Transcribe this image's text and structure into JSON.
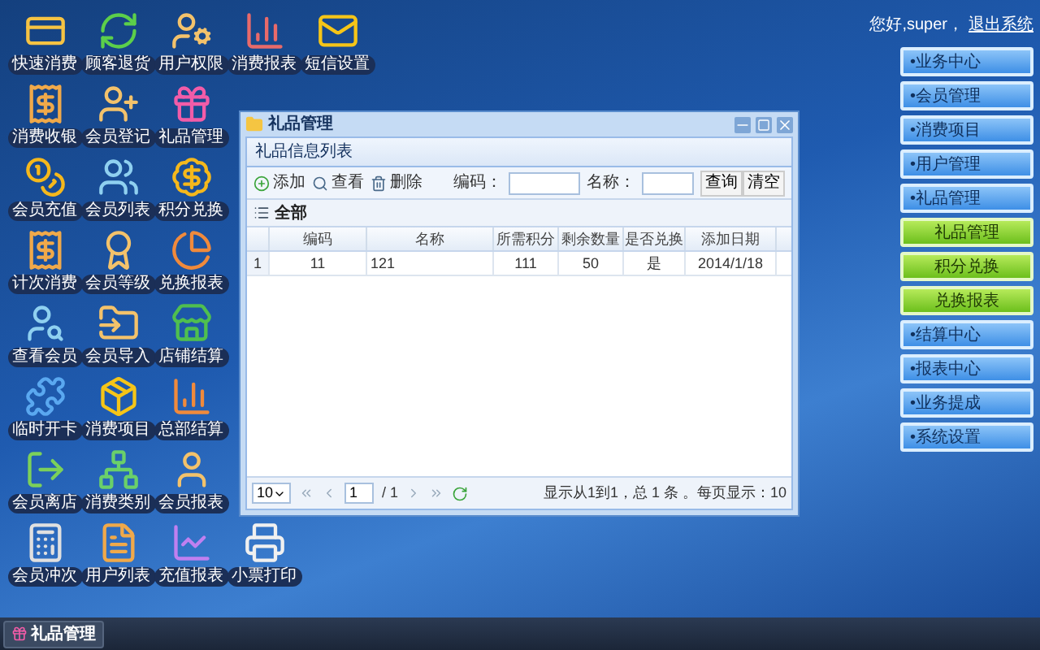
{
  "desktop_icons": [
    [
      "快速消费",
      "顾客退货",
      "用户权限",
      "消费报表",
      "短信设置"
    ],
    [
      "消费收银",
      "会员登记",
      "礼品管理"
    ],
    [
      "会员充值",
      "会员列表",
      "积分兑换"
    ],
    [
      "计次消费",
      "会员等级",
      "兑换报表"
    ],
    [
      "查看会员",
      "会员导入",
      "店铺结算"
    ],
    [
      "临时开卡",
      "消费项目",
      "总部结算"
    ],
    [
      "会员离店",
      "消费类别",
      "会员报表"
    ],
    [
      "会员冲次",
      "用户列表",
      "充值报表",
      "小票打印"
    ]
  ],
  "user_bar": {
    "greeting": "您好,super，",
    "logout": "退出系统"
  },
  "sidebar": {
    "items": [
      {
        "kind": "section",
        "label": "•业务中心"
      },
      {
        "kind": "section",
        "label": "•会员管理"
      },
      {
        "kind": "section",
        "label": "•消费项目"
      },
      {
        "kind": "section",
        "label": "•用户管理"
      },
      {
        "kind": "section",
        "label": "•礼品管理"
      },
      {
        "kind": "sub",
        "label": "礼品管理"
      },
      {
        "kind": "sub",
        "label": "积分兑换"
      },
      {
        "kind": "sub",
        "label": "兑换报表"
      },
      {
        "kind": "section",
        "label": "•结算中心"
      },
      {
        "kind": "section",
        "label": "•报表中心"
      },
      {
        "kind": "section",
        "label": "•业务提成"
      },
      {
        "kind": "section",
        "label": "•系统设置"
      }
    ]
  },
  "window": {
    "title": "礼品管理",
    "panel_title": "礼品信息列表",
    "toolbar": {
      "buttons": [
        "添加",
        "查看",
        "删除"
      ],
      "code_label": "编码：",
      "name_label": "名称：",
      "search": "查询",
      "clear": "清空"
    },
    "group": "全部",
    "table": {
      "columns": [
        "",
        "编码",
        "名称",
        "所需积分",
        "剩余数量",
        "是否兑换",
        "添加日期"
      ],
      "rows": [
        [
          "1",
          "11",
          "121",
          "111",
          "50",
          "是",
          "2014/1/18"
        ]
      ]
    },
    "pager": {
      "page_size": "10",
      "page": "1",
      "of": "/ 1",
      "summary": "显示从1到1，总 1 条 。每页显示：10"
    }
  },
  "taskbar": {
    "items": [
      "礼品管理"
    ]
  }
}
